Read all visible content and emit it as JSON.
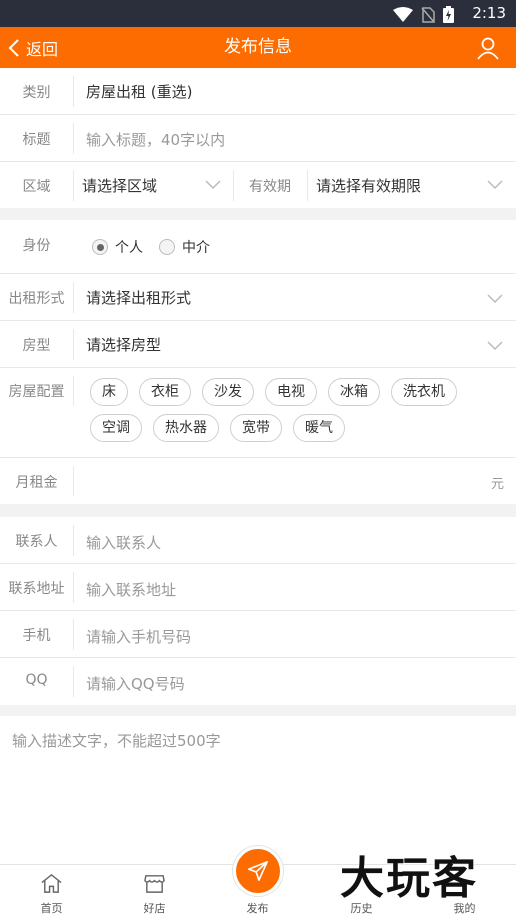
{
  "status": {
    "time": "2:13"
  },
  "header": {
    "back_label": "返回",
    "title": "发布信息"
  },
  "basic": {
    "category_label": "类别",
    "category_value": "房屋出租 (重选)",
    "title_label": "标题",
    "title_placeholder": "输入标题，40字以内",
    "area_label": "区域",
    "area_value": "请选择区域",
    "validity_label": "有效期",
    "validity_value": "请选择有效期限"
  },
  "details": {
    "identity_label": "身份",
    "identity_options": [
      "个人",
      "中介"
    ],
    "identity_selected": "个人",
    "rent_form_label": "出租形式",
    "rent_form_value": "请选择出租形式",
    "house_type_label": "房型",
    "house_type_value": "请选择房型",
    "config_label": "房屋配置",
    "config_items": [
      "床",
      "衣柜",
      "沙发",
      "电视",
      "冰箱",
      "洗衣机",
      "空调",
      "热水器",
      "宽带",
      "暖气"
    ],
    "rent_label": "月租金",
    "rent_unit": "元"
  },
  "contact": {
    "name_label": "联系人",
    "name_placeholder": "输入联系人",
    "address_label": "联系地址",
    "address_placeholder": "输入联系地址",
    "phone_label": "手机",
    "phone_placeholder": "请输入手机号码",
    "qq_label": "QQ",
    "qq_placeholder": "请输入QQ号码"
  },
  "description": {
    "placeholder": "输入描述文字，不能超过500字"
  },
  "tabbar": {
    "home": "首页",
    "shop": "好店",
    "publish": "发布",
    "history": "历史",
    "mine": "我的"
  },
  "watermark": "大玩客",
  "colors": {
    "accent": "#fd6c00",
    "statusbar": "#2b2e3b"
  }
}
